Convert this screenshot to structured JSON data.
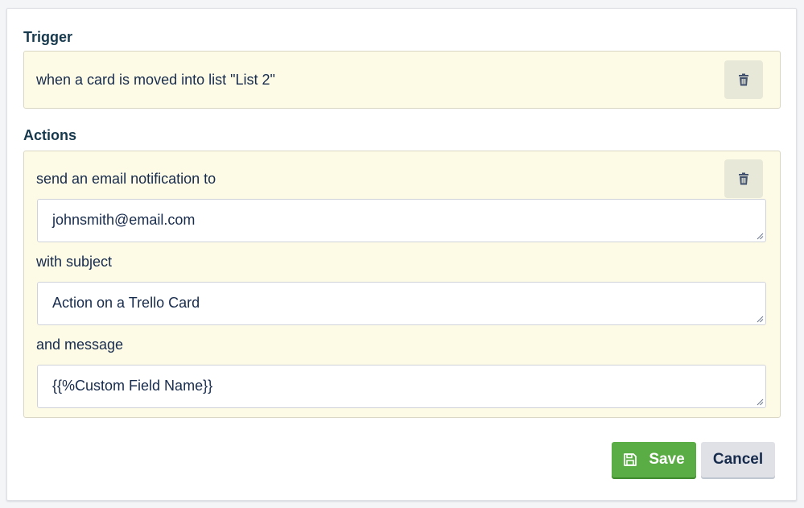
{
  "trigger": {
    "heading": "Trigger",
    "text": "when a card is moved into list \"List 2\""
  },
  "actions": {
    "heading": "Actions",
    "send_label": "send an email notification to",
    "email_value": "johnsmith@email.com",
    "subject_label": "with subject",
    "subject_value": "Action on a Trello Card",
    "message_label": "and message",
    "message_value": "{{%Custom Field Name}}"
  },
  "buttons": {
    "save_label": "Save",
    "cancel_label": "Cancel"
  },
  "icons": {
    "trash": "trash-icon",
    "save": "floppy-disk-icon"
  },
  "colors": {
    "accent_green": "#5aac44",
    "block_bg": "#fdfbe6"
  }
}
